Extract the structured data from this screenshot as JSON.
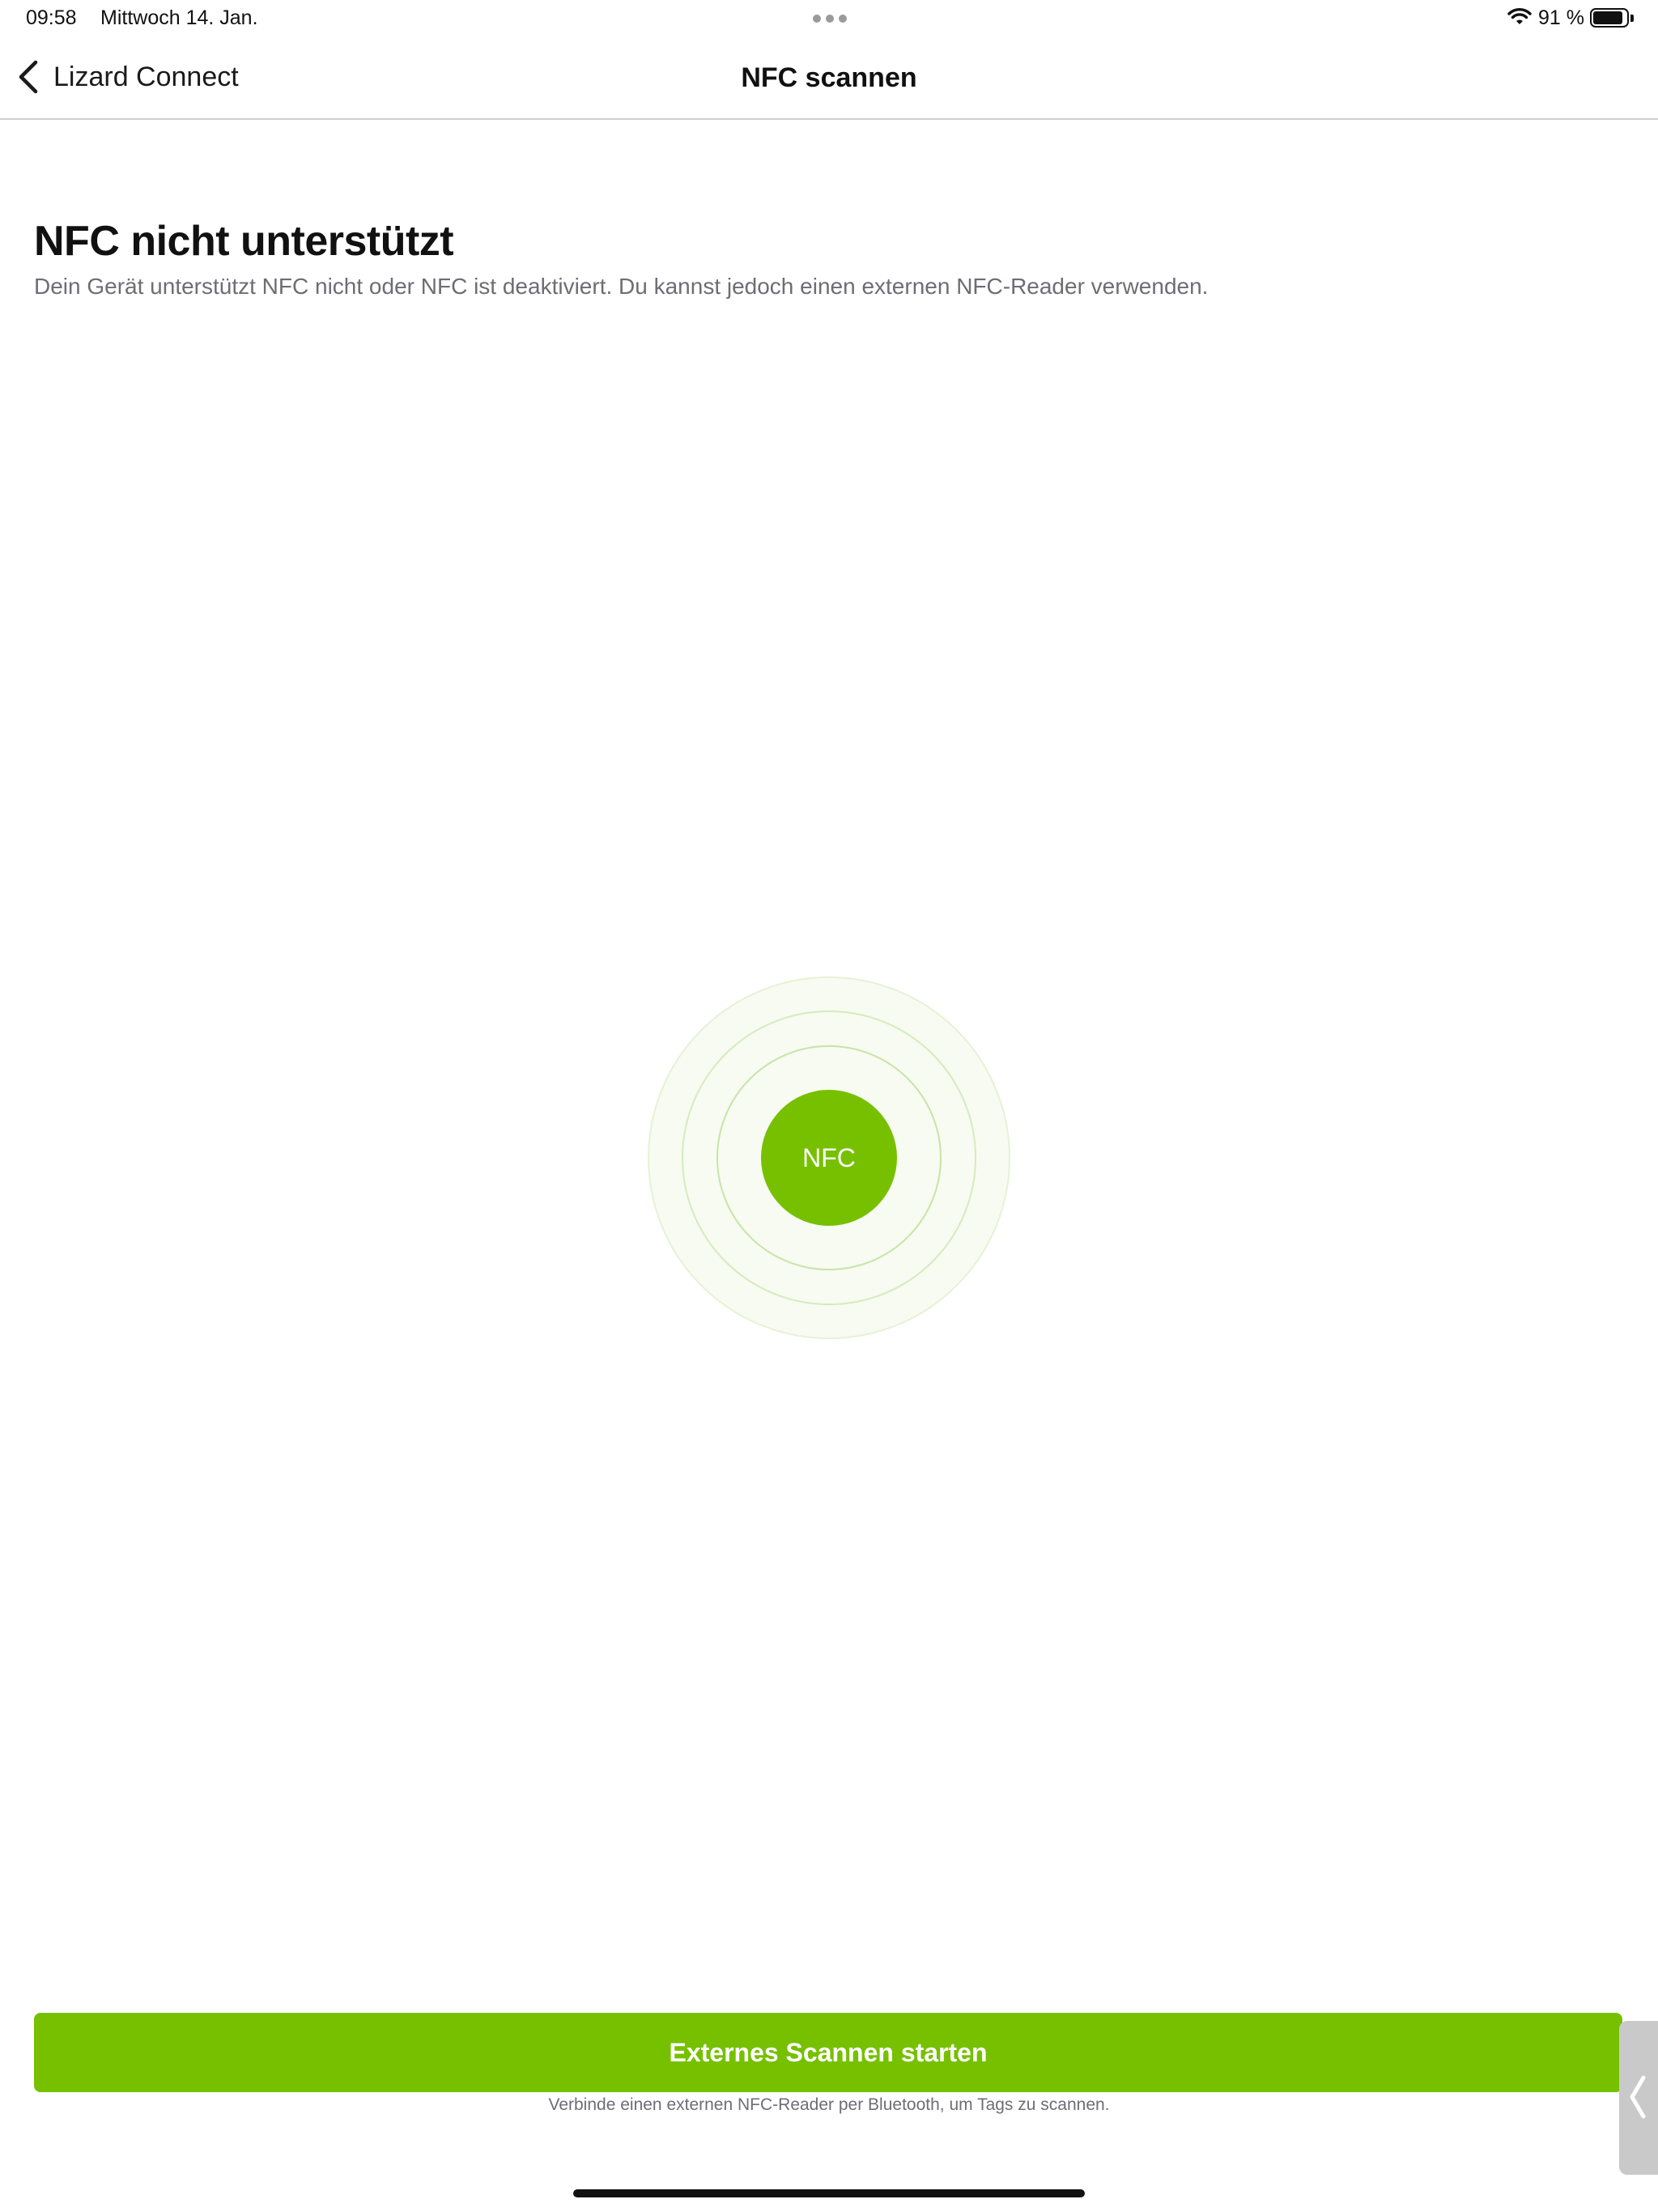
{
  "status_bar": {
    "time": "09:58",
    "date": "Mittwoch 14. Jan.",
    "battery_percent": "91 %",
    "battery_level": 0.91,
    "icons": [
      "more-dots-icon",
      "wifi-icon",
      "battery-icon"
    ]
  },
  "nav": {
    "back_label": "Lizard Connect",
    "title": "NFC scannen",
    "back_icon": "chevron-left-icon"
  },
  "content": {
    "title": "NFC nicht unterstützt",
    "description": "Dein Gerät unterstützt NFC nicht oder NFC ist deaktiviert. Du kannst jedoch einen externen NFC-Reader verwenden.",
    "nfc_badge": "NFC"
  },
  "footer": {
    "button_label": "Externes Scannen starten",
    "hint": "Verbinde einen externen NFC-Reader per Bluetooth, um Tags zu scannen."
  },
  "colors": {
    "accent": "#76c000",
    "secondary_text": "#6d6d75"
  }
}
